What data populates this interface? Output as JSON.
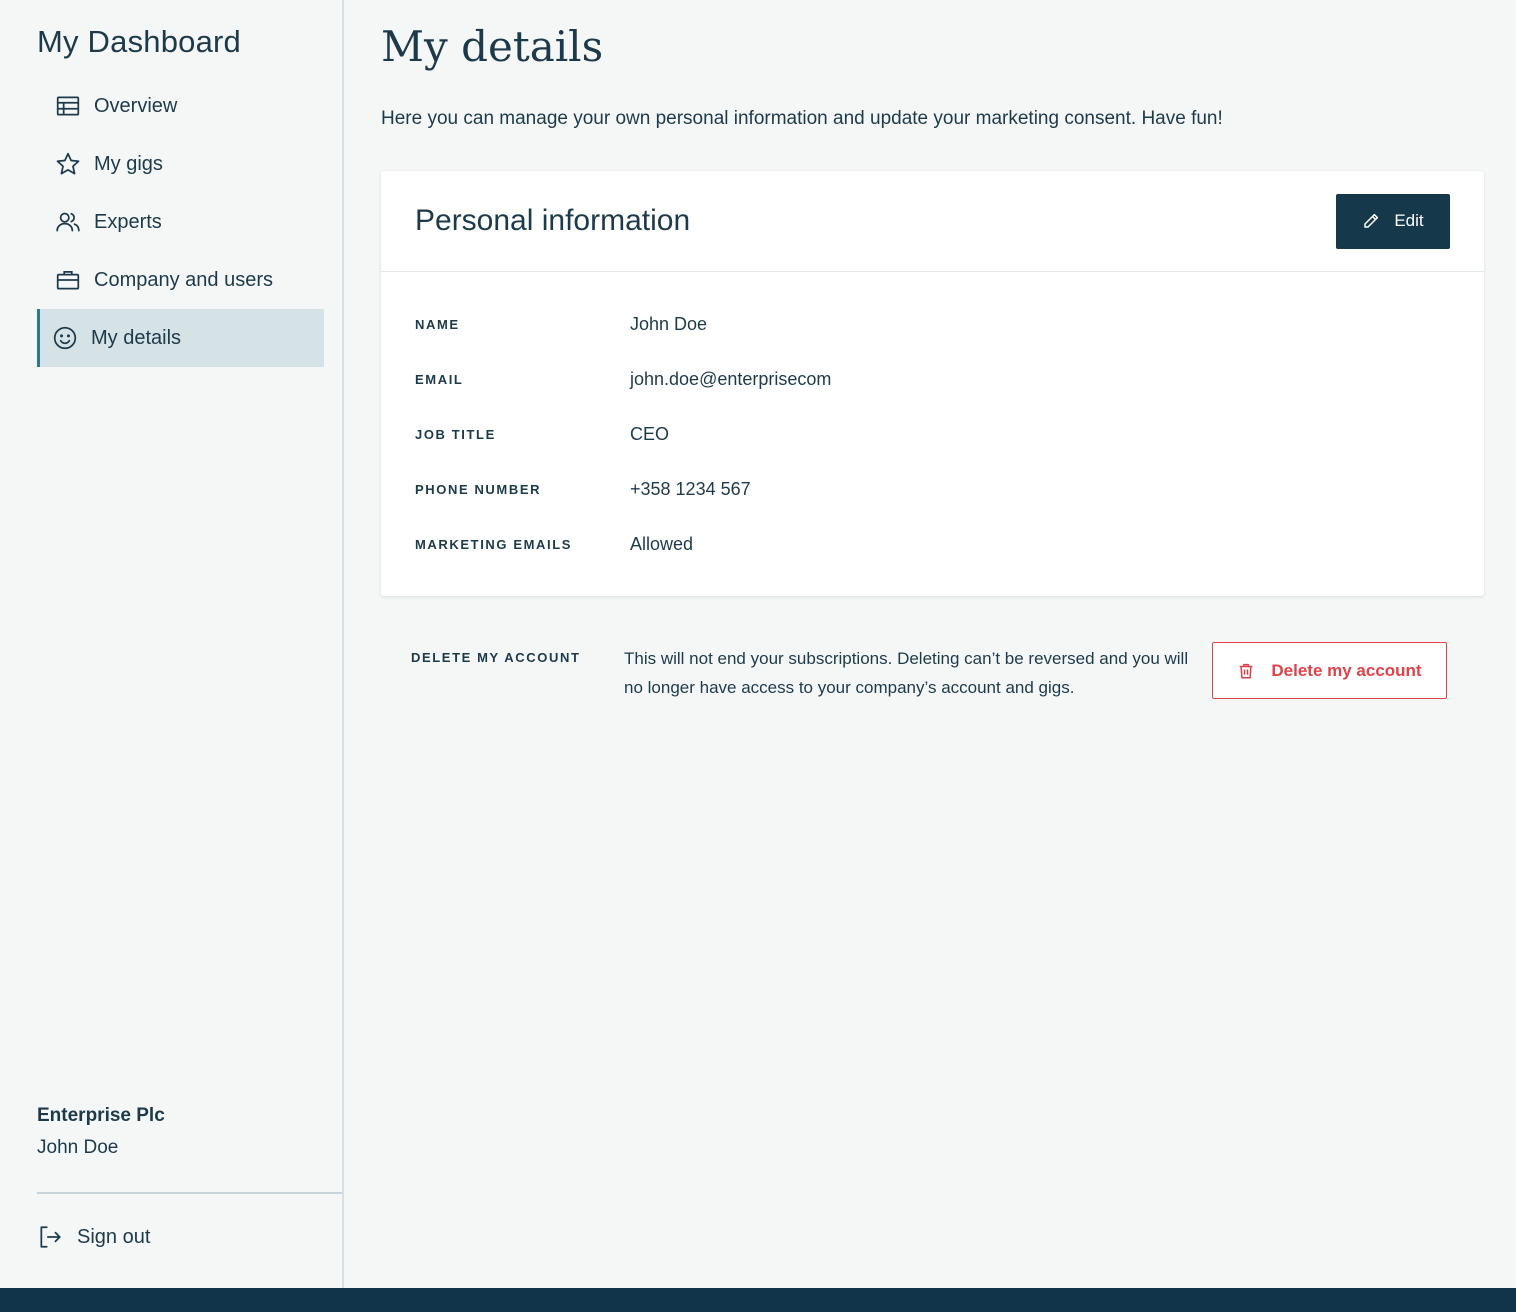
{
  "sidebar": {
    "title": "My Dashboard",
    "items": [
      {
        "label": "Overview",
        "icon": "table-icon"
      },
      {
        "label": "My gigs",
        "icon": "star-icon"
      },
      {
        "label": "Experts",
        "icon": "users-icon"
      },
      {
        "label": "Company and users",
        "icon": "briefcase-icon"
      },
      {
        "label": "My details",
        "icon": "smiley-icon",
        "active": true
      }
    ],
    "org_name": "Enterprise Plc",
    "user_name": "John Doe",
    "signout_label": "Sign out"
  },
  "main": {
    "title": "My details",
    "intro": "Here you can manage your own personal information and update your marketing consent. Have fun!",
    "card": {
      "title": "Personal information",
      "edit_label": "Edit",
      "fields": [
        {
          "label": "NAME",
          "value": "John Doe"
        },
        {
          "label": "EMAIL",
          "value": "john.doe@enterprisecom"
        },
        {
          "label": "JOB TITLE",
          "value": "CEO"
        },
        {
          "label": "PHONE NUMBER",
          "value": "+358 1234 567"
        },
        {
          "label": "MARKETING EMAILS",
          "value": "Allowed"
        }
      ]
    },
    "delete": {
      "label": "DELETE MY ACCOUNT",
      "text": "This will not end your subscriptions. Deleting can’t be reversed and you will no longer have access to your company’s account and gigs.",
      "button_label": "Delete my account"
    }
  },
  "colors": {
    "primary": "#15394b",
    "text": "#1d3a4b",
    "active_bg": "#d5e3e6",
    "active_accent": "#2a7a94",
    "danger": "#e0424a",
    "page_bg": "#f5f7f7"
  }
}
